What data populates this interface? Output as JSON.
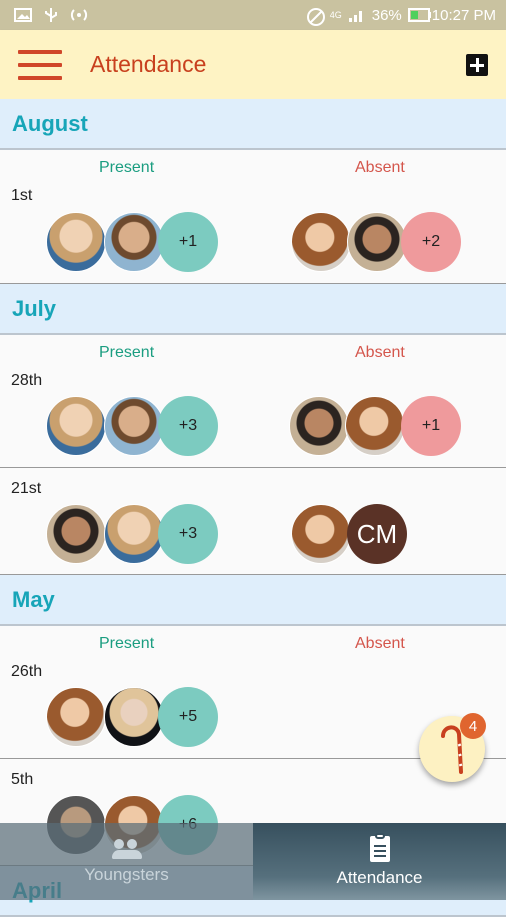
{
  "status_bar": {
    "battery": "36%",
    "time": "10:27 PM",
    "network": "4G"
  },
  "app_bar": {
    "title": "Attendance"
  },
  "labels": {
    "present": "Present",
    "absent": "Absent"
  },
  "months": [
    {
      "name": "August",
      "days": [
        {
          "date": "1st",
          "present_extra": "+1",
          "absent_extra": "+2"
        }
      ]
    },
    {
      "name": "July",
      "days": [
        {
          "date": "28th",
          "present_extra": "+3",
          "absent_extra": "+1"
        },
        {
          "date": "21st",
          "present_extra": "+3",
          "absent_initials": "CM"
        }
      ]
    },
    {
      "name": "May",
      "days": [
        {
          "date": "26th",
          "present_extra": "+5"
        },
        {
          "date": "5th",
          "present_extra": "+6"
        }
      ]
    },
    {
      "name": "April"
    }
  ],
  "bottom_nav": [
    {
      "label": "Youngsters",
      "icon": "people-icon",
      "active": false
    },
    {
      "label": "Attendance",
      "icon": "clipboard-icon",
      "active": true
    }
  ],
  "fab": {
    "icon": "cane-icon",
    "badge": "4"
  }
}
